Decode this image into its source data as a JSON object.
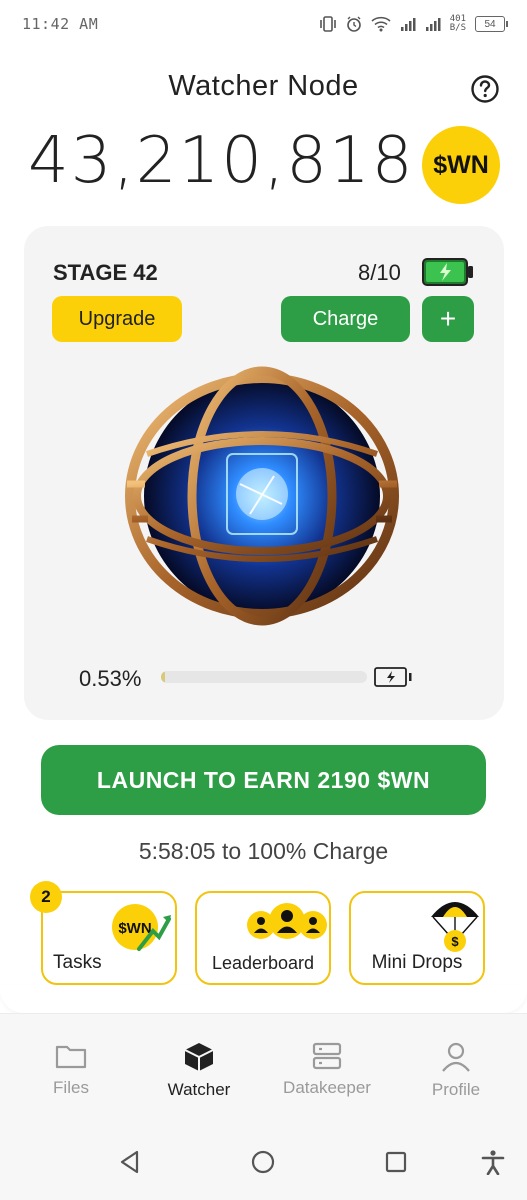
{
  "status_bar": {
    "time": "11:42 AM",
    "speed_value": "401",
    "speed_unit": "B/S",
    "battery_level": "54"
  },
  "header": {
    "title": "Watcher Node"
  },
  "balance": {
    "amount": "43,210,818",
    "token_logo": "$WN"
  },
  "stage_card": {
    "stage_label": "STAGE 42",
    "charges_count": "8/10",
    "upgrade_label": "Upgrade",
    "charge_label": "Charge",
    "plus_label": "+",
    "progress_percent_label": "0.53%",
    "progress_fraction": 0.0053
  },
  "launch_button": {
    "label": "LAUNCH TO EARN 2190 $WN"
  },
  "charge_timer": {
    "text": "5:58:05  to 100% Charge"
  },
  "actions": {
    "tasks": {
      "label": "Tasks",
      "badge": "2",
      "icon_text": "$WN"
    },
    "leaderboard": {
      "label": "Leaderboard"
    },
    "mini_drops": {
      "label": "Mini Drops",
      "icon_text": "$"
    }
  },
  "bottom_nav": {
    "items": [
      {
        "label": "Files",
        "icon": "folder-icon",
        "active": false
      },
      {
        "label": "Watcher",
        "icon": "cube-icon",
        "active": true
      },
      {
        "label": "Datakeeper",
        "icon": "server-icon",
        "active": false
      },
      {
        "label": "Profile",
        "icon": "user-icon",
        "active": false
      }
    ]
  },
  "colors": {
    "accent_green": "#2e9e46",
    "accent_yellow": "#fcd008",
    "card_background": "#f4f4f4"
  }
}
